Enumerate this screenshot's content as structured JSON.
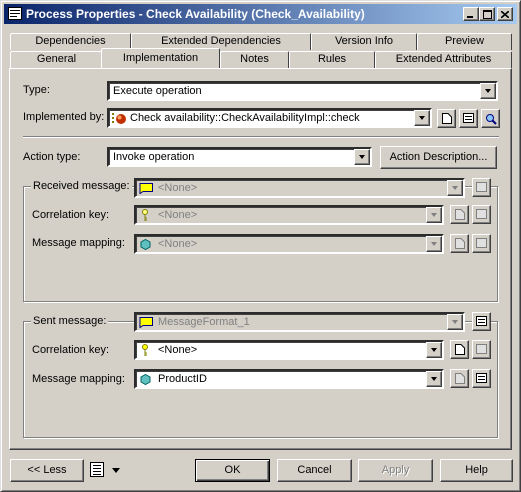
{
  "window": {
    "title": "Process Properties - Check Availability (Check_Availability)"
  },
  "tabs_back": [
    "Dependencies",
    "Extended Dependencies",
    "Version Info",
    "Preview"
  ],
  "tabs_front": [
    "General",
    "Implementation",
    "Notes",
    "Rules",
    "Extended Attributes"
  ],
  "active_tab": "Implementation",
  "type": {
    "label": "Type:",
    "value": "Execute operation"
  },
  "implemented_by": {
    "label": "Implemented by:",
    "value": "Check availability::CheckAvailabilityImpl::check"
  },
  "action_type": {
    "label": "Action type:",
    "value": "Invoke operation",
    "description_button": "Action Description..."
  },
  "received_group": {
    "message_label": "Received message:",
    "message_value": "<None>",
    "correlation_label": "Correlation key:",
    "correlation_value": "<None>",
    "mapping_label": "Message mapping:",
    "mapping_value": "<None>"
  },
  "sent_group": {
    "message_label": "Sent message:",
    "message_value": "MessageFormat_1",
    "correlation_label": "Correlation key:",
    "correlation_value": "<None>",
    "mapping_label": "Message mapping:",
    "mapping_value": "ProductID"
  },
  "buttons": {
    "less": "<< Less",
    "ok": "OK",
    "cancel": "Cancel",
    "apply": "Apply",
    "help": "Help"
  }
}
